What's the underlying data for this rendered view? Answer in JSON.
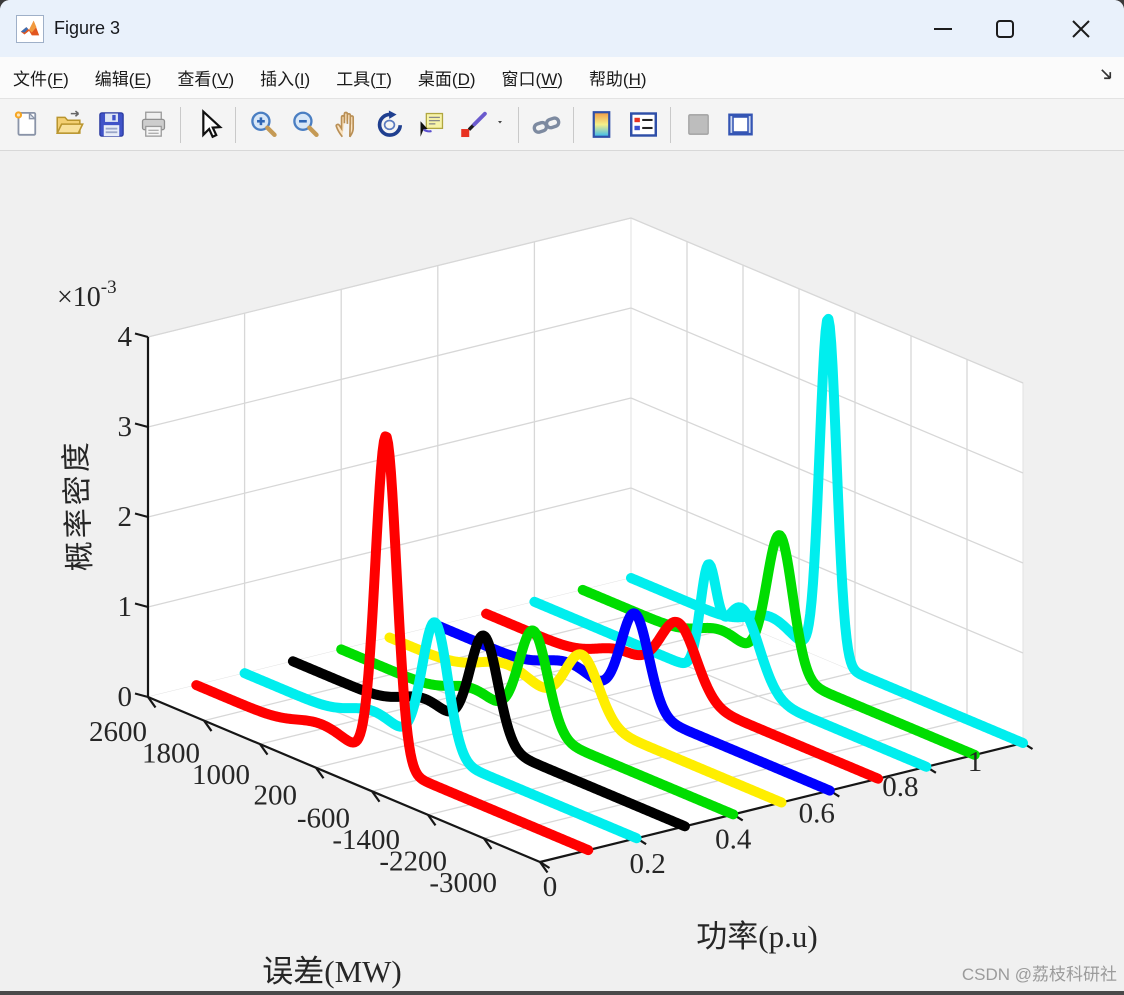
{
  "window": {
    "title": "Figure 3"
  },
  "menu": {
    "items": [
      {
        "name": "file",
        "label": "文件",
        "key": "F"
      },
      {
        "name": "edit",
        "label": "编辑",
        "key": "E"
      },
      {
        "name": "view",
        "label": "查看",
        "key": "V"
      },
      {
        "name": "insert",
        "label": "插入",
        "key": "I"
      },
      {
        "name": "tools",
        "label": "工具",
        "key": "T"
      },
      {
        "name": "desktop",
        "label": "桌面",
        "key": "D"
      },
      {
        "name": "window",
        "label": "窗口",
        "key": "W"
      },
      {
        "name": "help",
        "label": "帮助",
        "key": "H"
      }
    ]
  },
  "toolbar": {
    "buttons": [
      "new-figure",
      "open-file",
      "save-figure",
      "print-figure",
      "|",
      "cursor",
      "|",
      "zoom-in",
      "zoom-out",
      "pan",
      "rotate-3d",
      "data-cursor",
      "brush",
      "brush-dropdown",
      "|",
      "link-plot",
      "|",
      "insert-colorbar",
      "insert-legend",
      "|",
      "insert-axes-disabled",
      "dock-figure"
    ]
  },
  "watermark": "CSDN @荔枝科研社",
  "chart_data": {
    "type": "line",
    "projection": "3d-waterfall-ridgeline",
    "title": "",
    "xlabel": "误差(MW)",
    "ylabel": "功率(p.u)",
    "zlabel": "概率密度",
    "z_multiplier_base": "×10",
    "z_multiplier_exp": "-3",
    "x_ticks": [
      2600,
      1800,
      1000,
      200,
      -600,
      -1400,
      -2200,
      -3000
    ],
    "x_range": [
      2600,
      -3000
    ],
    "y_ticks": [
      "0",
      "0.2",
      "0.4",
      "0.6",
      "0.8",
      "1"
    ],
    "y_tick_values": [
      0,
      0.2,
      0.4,
      0.6,
      0.8,
      1
    ],
    "y_range": [
      0,
      1
    ],
    "z_ticks": [
      0,
      1,
      2,
      3,
      4
    ],
    "z_range": [
      0,
      4
    ],
    "z_units": "1e-3",
    "grid": true,
    "legend": "none",
    "series": [
      {
        "name": "pdf-power-0.1",
        "power": 0.1,
        "color": "red",
        "hex": "#ff0000",
        "peaks": [
          {
            "center": -110,
            "height": 3.65,
            "sigma": 150
          },
          {
            "center": 800,
            "height": 0.15,
            "sigma": 350
          }
        ]
      },
      {
        "name": "pdf-power-0.2",
        "power": 0.2,
        "color": "cyan",
        "hex": "#00eeee",
        "peaks": [
          {
            "center": -120,
            "height": 1.45,
            "sigma": 185
          },
          {
            "center": 750,
            "height": 0.18,
            "sigma": 330
          }
        ]
      },
      {
        "name": "pdf-power-0.3",
        "power": 0.3,
        "color": "black",
        "hex": "#000000",
        "peaks": [
          {
            "center": -130,
            "height": 1.17,
            "sigma": 200
          },
          {
            "center": 700,
            "height": 0.2,
            "sigma": 330
          }
        ]
      },
      {
        "name": "pdf-power-0.4",
        "power": 0.4,
        "color": "green",
        "hex": "#00dd00",
        "peaks": [
          {
            "center": -145,
            "height": 1.1,
            "sigma": 205
          },
          {
            "center": 700,
            "height": 0.18,
            "sigma": 330
          }
        ]
      },
      {
        "name": "pdf-power-0.5",
        "power": 0.5,
        "color": "yellow",
        "hex": "#ffee00",
        "peaks": [
          {
            "center": -150,
            "height": 0.7,
            "sigma": 240
          },
          {
            "center": 900,
            "height": 0.25,
            "sigma": 400
          }
        ]
      },
      {
        "name": "pdf-power-0.6",
        "power": 0.6,
        "color": "blue",
        "hex": "#0000ff",
        "peaks": [
          {
            "center": -215,
            "height": 1.05,
            "sigma": 200
          },
          {
            "center": 700,
            "height": 0.2,
            "sigma": 350
          }
        ]
      },
      {
        "name": "pdf-power-0.7",
        "power": 0.7,
        "color": "red",
        "hex": "#ff0000",
        "peaks": [
          {
            "center": -145,
            "height": 0.78,
            "sigma": 260
          },
          {
            "center": 650,
            "height": 0.22,
            "sigma": 360
          }
        ]
      },
      {
        "name": "pdf-power-0.8",
        "power": 0.8,
        "color": "cyan",
        "hex": "#00eeee",
        "peaks": [
          {
            "center": 120,
            "height": 1.05,
            "sigma": 115
          },
          {
            "center": -350,
            "height": 0.9,
            "sigma": 260
          }
        ]
      },
      {
        "name": "pdf-power-0.9",
        "power": 0.9,
        "color": "green",
        "hex": "#00dd00",
        "peaks": [
          {
            "center": -215,
            "height": 1.52,
            "sigma": 185
          },
          {
            "center": 600,
            "height": 0.2,
            "sigma": 330
          }
        ]
      },
      {
        "name": "pdf-power-1.0",
        "power": 1.0,
        "color": "cyan",
        "hex": "#00eeee",
        "peaks": [
          {
            "center": -215,
            "height": 3.8,
            "sigma": 120
          },
          {
            "center": 600,
            "height": 0.22,
            "sigma": 300
          }
        ]
      }
    ]
  }
}
